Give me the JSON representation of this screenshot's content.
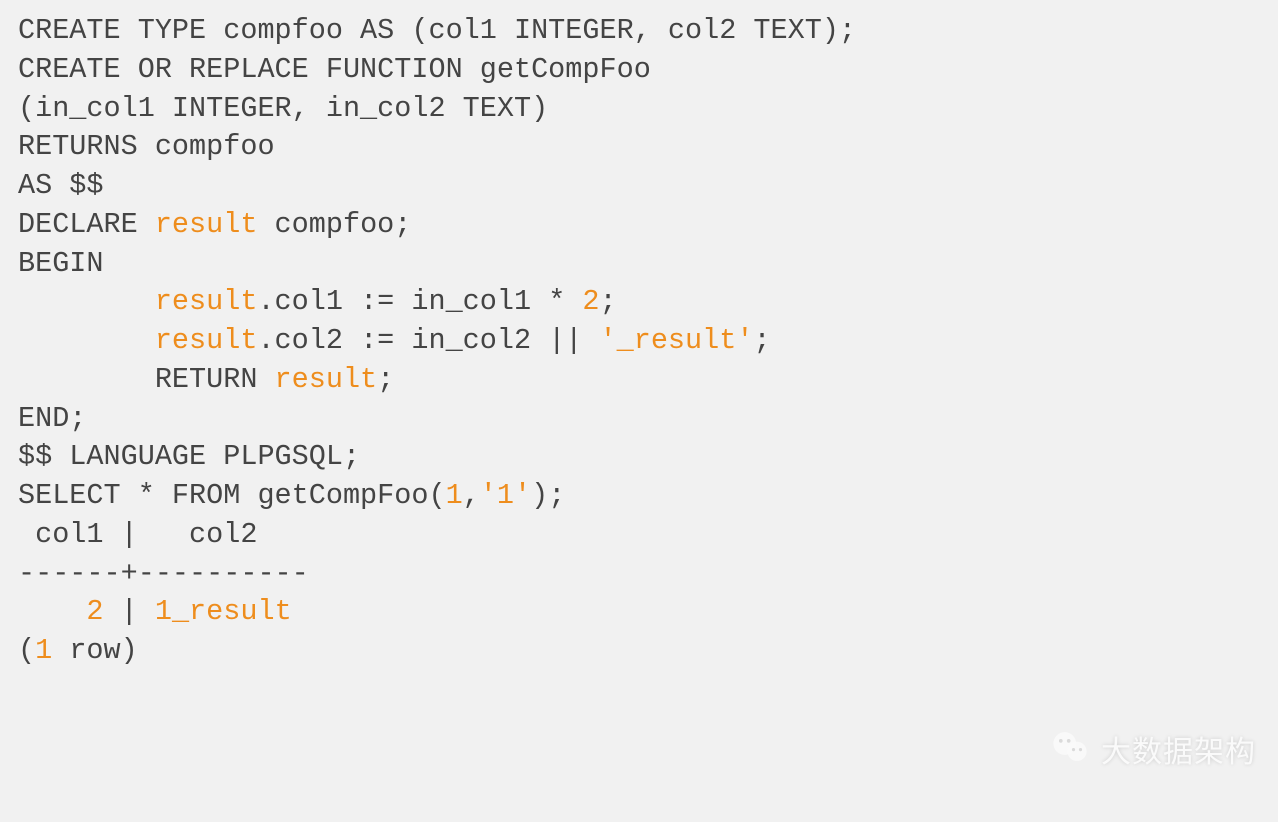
{
  "code": {
    "lines": [
      [
        {
          "text": "CREATE TYPE compfoo AS (col1 INTEGER, col2 TEXT);",
          "cls": "t-default"
        }
      ],
      [
        {
          "text": "CREATE OR REPLACE FUNCTION getCompFoo",
          "cls": "t-default"
        }
      ],
      [
        {
          "text": "(in_col1 INTEGER, in_col2 TEXT)",
          "cls": "t-default"
        }
      ],
      [
        {
          "text": "RETURNS compfoo",
          "cls": "t-default"
        }
      ],
      [
        {
          "text": "AS $$",
          "cls": "t-default"
        }
      ],
      [
        {
          "text": "DECLARE ",
          "cls": "t-default"
        },
        {
          "text": "result",
          "cls": "t-orange"
        },
        {
          "text": " compfoo;",
          "cls": "t-default"
        }
      ],
      [
        {
          "text": "BEGIN",
          "cls": "t-default"
        }
      ],
      [
        {
          "text": "        ",
          "cls": "t-default"
        },
        {
          "text": "result",
          "cls": "t-orange"
        },
        {
          "text": ".col1 := in_col1 * ",
          "cls": "t-default"
        },
        {
          "text": "2",
          "cls": "t-orange"
        },
        {
          "text": ";",
          "cls": "t-default"
        }
      ],
      [
        {
          "text": "        ",
          "cls": "t-default"
        },
        {
          "text": "result",
          "cls": "t-orange"
        },
        {
          "text": ".col2 := in_col2 || ",
          "cls": "t-default"
        },
        {
          "text": "'_result'",
          "cls": "t-orange"
        },
        {
          "text": ";",
          "cls": "t-default"
        }
      ],
      [
        {
          "text": "        RETURN ",
          "cls": "t-default"
        },
        {
          "text": "result",
          "cls": "t-orange"
        },
        {
          "text": ";",
          "cls": "t-default"
        }
      ],
      [
        {
          "text": "END;",
          "cls": "t-default"
        }
      ],
      [
        {
          "text": "$$ LANGUAGE PLPGSQL;",
          "cls": "t-default"
        }
      ],
      [
        {
          "text": "SELECT * FROM getCompFoo(",
          "cls": "t-default"
        },
        {
          "text": "1",
          "cls": "t-orange"
        },
        {
          "text": ",",
          "cls": "t-default"
        },
        {
          "text": "'1'",
          "cls": "t-orange"
        },
        {
          "text": ");",
          "cls": "t-default"
        }
      ],
      [
        {
          "text": " col1 |   col2",
          "cls": "t-default"
        }
      ],
      [
        {
          "text": "------+----------",
          "cls": "t-default"
        }
      ],
      [
        {
          "text": "    ",
          "cls": "t-default"
        },
        {
          "text": "2",
          "cls": "t-orange"
        },
        {
          "text": " | ",
          "cls": "t-default"
        },
        {
          "text": "1",
          "cls": "t-orange"
        },
        {
          "text": "_result",
          "cls": "t-orange"
        }
      ],
      [
        {
          "text": "(",
          "cls": "t-default"
        },
        {
          "text": "1",
          "cls": "t-orange"
        },
        {
          "text": " row)",
          "cls": "t-default"
        }
      ]
    ]
  },
  "watermark": {
    "text": "大数据架构"
  }
}
